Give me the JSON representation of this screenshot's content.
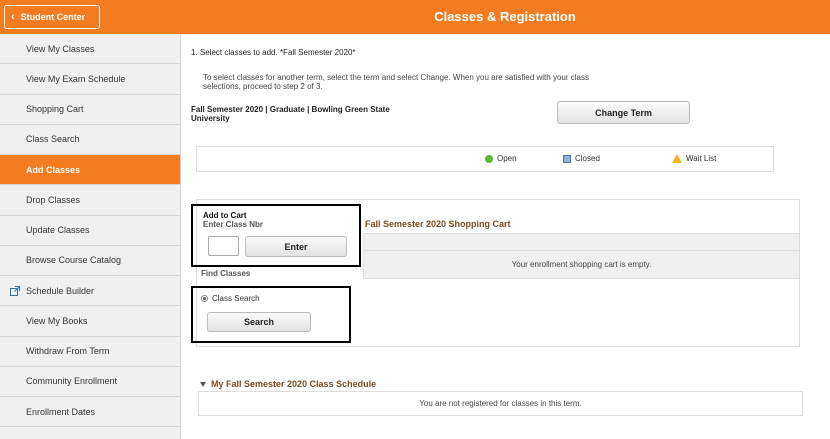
{
  "header": {
    "back_label": "Student Center",
    "title": "Classes & Registration",
    "brand_color": "#f47c20"
  },
  "sidebar": {
    "items": [
      {
        "label": "View My Classes",
        "active": false
      },
      {
        "label": "View My Exam Schedule",
        "active": false
      },
      {
        "label": "Shopping Cart",
        "active": false
      },
      {
        "label": "Class Search",
        "active": false
      },
      {
        "label": "Add Classes",
        "active": true
      },
      {
        "label": "Drop Classes",
        "active": false
      },
      {
        "label": "Update Classes",
        "active": false
      },
      {
        "label": "Browse Course Catalog",
        "active": false
      },
      {
        "label": "Schedule Builder",
        "active": false,
        "icon": "external-link-icon"
      },
      {
        "label": "View My Books",
        "active": false
      },
      {
        "label": "Withdraw From Term",
        "active": false
      },
      {
        "label": "Community Enrollment",
        "active": false
      },
      {
        "label": "Enrollment Dates",
        "active": false
      }
    ]
  },
  "main": {
    "step_text": "1.  Select classes to add.  *Fall Semester 2020*",
    "instructions": "To select classes for another term, select the term and select Change.  When you are satisfied with your class selections, proceed to step 2 of 3.",
    "term_info": "Fall Semester 2020 | Graduate | Bowling Green State University",
    "change_term_label": "Change Term",
    "legend": {
      "open": "Open",
      "closed": "Closed",
      "wait_list": "Wait List"
    },
    "add_to_cart": {
      "title": "Add to Cart",
      "subtitle": "Enter Class Nbr",
      "input_value": "",
      "enter_label": "Enter"
    },
    "find_classes": {
      "label": "Find Classes",
      "radio_label": "Class Search",
      "search_label": "Search"
    },
    "shopping_cart": {
      "title": "Fall Semester 2020 Shopping Cart",
      "empty_message": "Your enrollment shopping cart is empty."
    },
    "schedule": {
      "title": "My Fall Semester 2020 Class Schedule",
      "message": "You are not registered for classes in this term."
    }
  }
}
